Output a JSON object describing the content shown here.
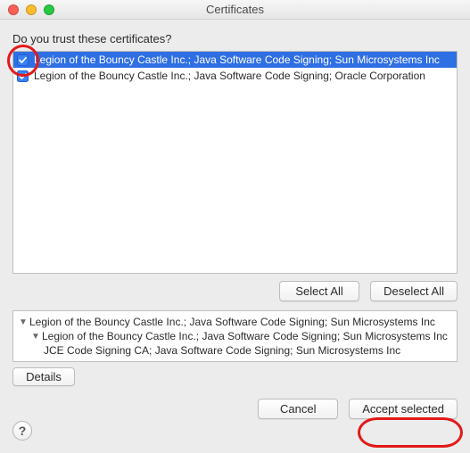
{
  "window": {
    "title": "Certificates"
  },
  "prompt": "Do you trust these certificates?",
  "colors": {
    "selection": "#2f6fe4",
    "annotation": "#e21a1a"
  },
  "list": {
    "rows": [
      {
        "checked": true,
        "selected": true,
        "label": "Legion of the Bouncy Castle Inc.; Java Software Code Signing; Sun Microsystems Inc"
      },
      {
        "checked": true,
        "selected": false,
        "label": "Legion of the Bouncy Castle Inc.; Java Software Code Signing; Oracle Corporation"
      }
    ]
  },
  "buttons": {
    "select_all": "Select All",
    "deselect_all": "Deselect All",
    "details": "Details",
    "cancel": "Cancel",
    "accept": "Accept selected"
  },
  "tree": {
    "r0": "Legion of the Bouncy Castle Inc.; Java Software Code Signing; Sun Microsystems Inc",
    "r1": "Legion of the Bouncy Castle Inc.; Java Software Code Signing; Sun Microsystems Inc",
    "r2": "JCE Code Signing CA; Java Software Code Signing; Sun Microsystems Inc"
  },
  "icons": {
    "checkbox_checked": "checkbox-checked-icon",
    "disclosure_down": "▼",
    "help": "?"
  }
}
